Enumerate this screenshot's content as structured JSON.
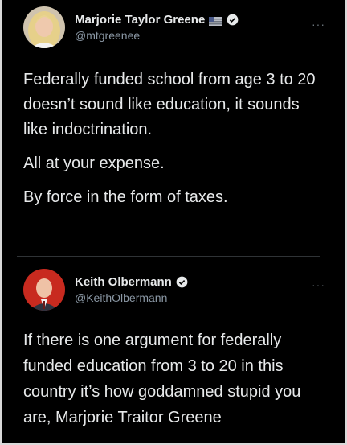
{
  "tweets": [
    {
      "display_name": "Marjorie Taylor Greene",
      "handle": "@mtgreenee",
      "has_flag": true,
      "verified": true,
      "more_label": "···",
      "paragraphs": [
        "Federally funded school from age 3 to 20 doesn’t sound like education, it sounds like indoctrination.",
        "All at your expense.",
        "By force in the form of taxes."
      ]
    },
    {
      "display_name": "Keith Olbermann",
      "handle": "@KeithOlbermann",
      "verified": true,
      "more_label": "···",
      "paragraphs": [
        "If there is one argument for federally funded education from 3 to 20 in this country it’s how goddamned stupid you are, Marjorie Traitor Greene"
      ]
    }
  ],
  "colors": {
    "background": "#000000",
    "text": "#e7e9ea",
    "handle": "#8b98a5",
    "verified": "#e7e9ea"
  }
}
